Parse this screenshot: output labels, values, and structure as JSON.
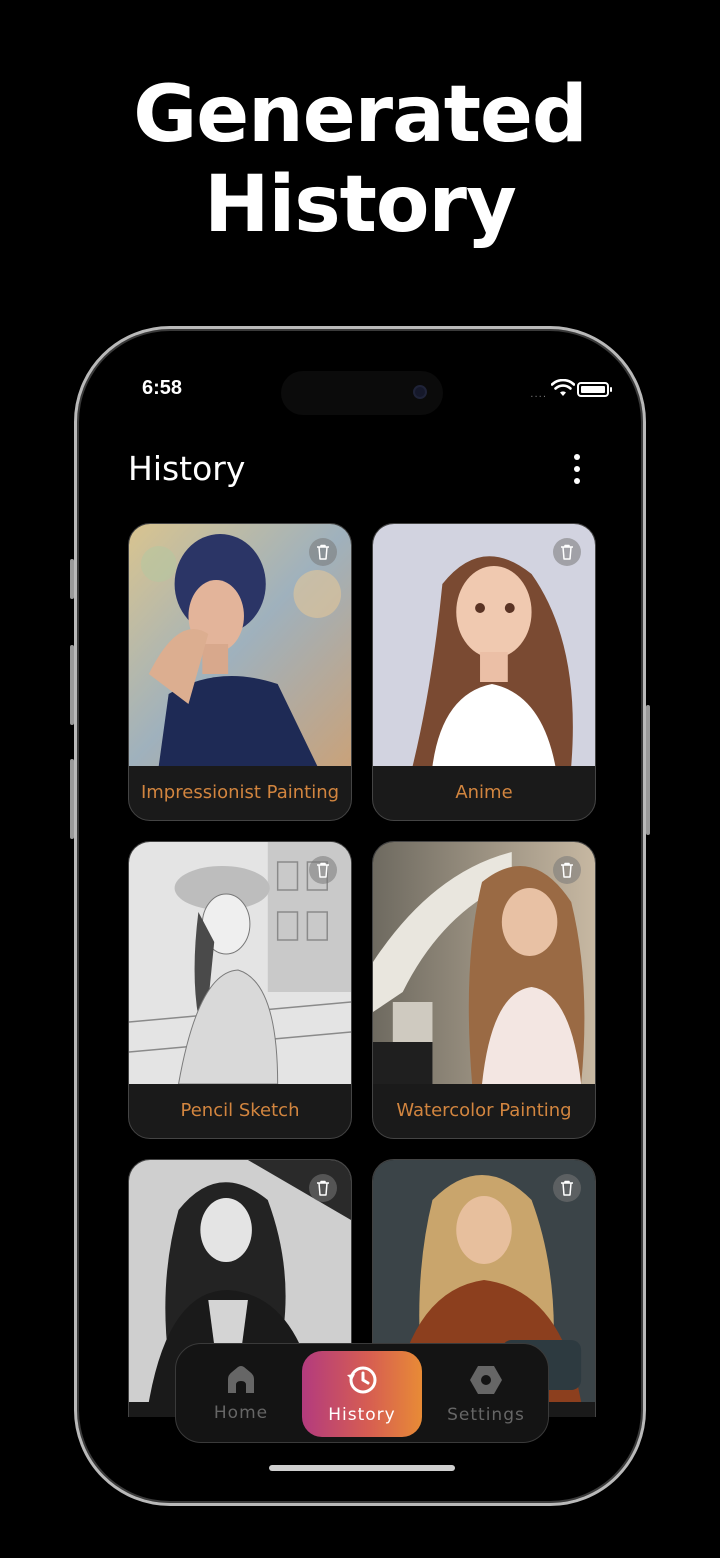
{
  "headline": {
    "line1": "Generated",
    "line2": "History"
  },
  "status": {
    "time": "6:58",
    "signal": "....",
    "wifi_icon": "wifi-icon",
    "battery_icon": "battery-icon"
  },
  "appbar": {
    "title": "History",
    "menu_icon": "more-vertical-icon"
  },
  "cards": [
    {
      "label": "Impressionist Painting",
      "icon": "trash-icon"
    },
    {
      "label": "Anime",
      "icon": "trash-icon"
    },
    {
      "label": "Pencil Sketch",
      "icon": "trash-icon"
    },
    {
      "label": "Watercolor Painting",
      "icon": "trash-icon"
    },
    {
      "label": "",
      "icon": "trash-icon"
    },
    {
      "label": "",
      "icon": "trash-icon"
    }
  ],
  "nav": {
    "home": "Home",
    "history": "History",
    "settings": "Settings"
  },
  "colors": {
    "accent_label": "#d2853f",
    "nav_gradient_start": "#b33b7e",
    "nav_gradient_end": "#e88b36"
  }
}
